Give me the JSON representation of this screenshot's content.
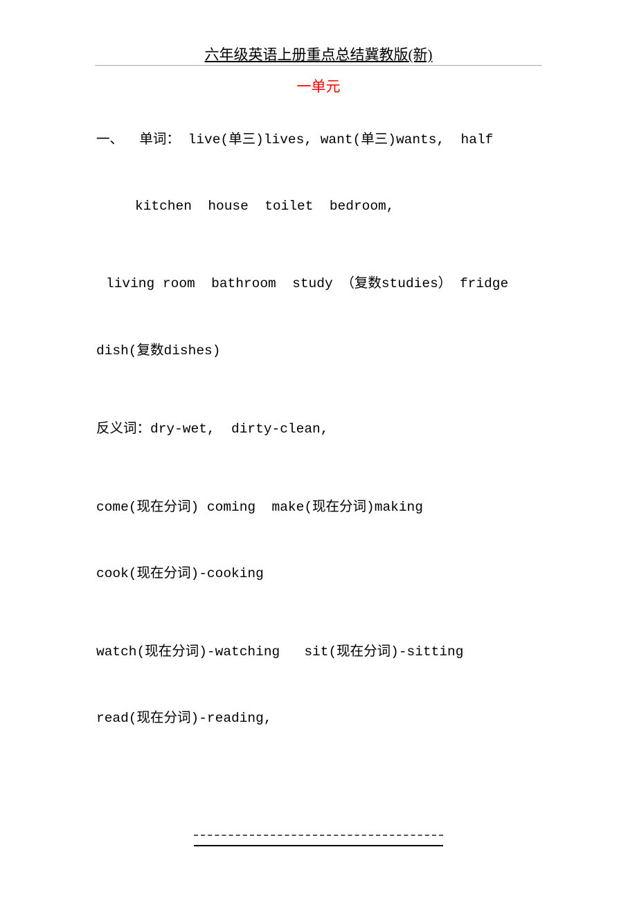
{
  "header": {
    "title": "六年级英语上册重点总结冀教版(新)"
  },
  "unit_title": "一单元",
  "lines": [
    "一、  单词： live(单三)lives, want(单三)wants,  half",
    "kitchen  house  toilet  bedroom,",
    "living room  bathroom  study （复数studies） fridge",
    "dish(复数dishes)",
    "反义词：dry-wet,  dirty-clean,",
    "come(现在分词) coming  make(现在分词)making",
    "cook(现在分词)-cooking",
    "watch(现在分词)-watching   sit(现在分词)-sitting",
    "read(现在分词)-reading,"
  ]
}
